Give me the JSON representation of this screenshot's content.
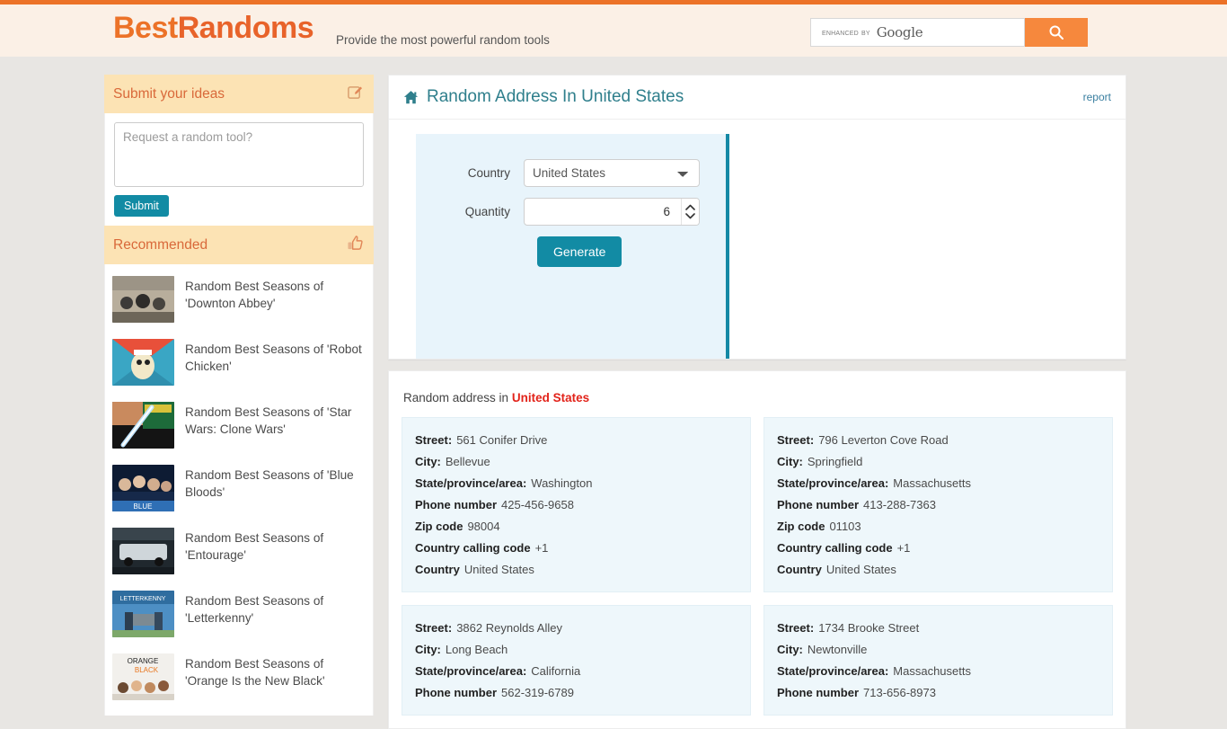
{
  "header": {
    "brand_first": "Best",
    "brand_second": "Randoms",
    "tagline": "Provide the most powerful random tools",
    "search": {
      "enhanced_label": "enhanced by",
      "google_label": "Google",
      "placeholder": "",
      "value": "",
      "button_icon": "search-icon"
    },
    "accent_color": "#ec7228",
    "background_color": "#fbf0e6"
  },
  "sidebar": {
    "ideas_panel": {
      "title": "Submit your ideas",
      "icon": "edit-pencil-icon",
      "textarea_placeholder": "Request a random tool?",
      "textarea_value": "",
      "submit_label": "Submit"
    },
    "recommended_panel": {
      "title": "Recommended",
      "icon": "thumbs-up-icon",
      "items": [
        {
          "label": "Random Best Seasons of 'Downton Abbey'",
          "thumb": "downton-abbey-thumb"
        },
        {
          "label": "Random Best Seasons of 'Robot Chicken'",
          "thumb": "robot-chicken-thumb"
        },
        {
          "label": "Random Best Seasons of 'Star Wars: Clone Wars'",
          "thumb": "star-wars-clone-wars-thumb"
        },
        {
          "label": "Random Best Seasons of 'Blue Bloods'",
          "thumb": "blue-bloods-thumb"
        },
        {
          "label": "Random Best Seasons of 'Entourage'",
          "thumb": "entourage-thumb"
        },
        {
          "label": "Random Best Seasons of 'Letterkenny'",
          "thumb": "letterkenny-thumb"
        },
        {
          "label": "Random Best Seasons of 'Orange Is the New Black'",
          "thumb": "orange-is-the-new-black-thumb"
        }
      ]
    }
  },
  "main": {
    "page_title": "Random Address In United States",
    "home_icon": "home-icon",
    "report_label": "report",
    "accent_color": "#1589a5",
    "form": {
      "country_label": "Country",
      "country_value": "United States",
      "country_options": [
        "United States"
      ],
      "quantity_label": "Quantity",
      "quantity_value": "6",
      "generate_label": "Generate"
    },
    "results": {
      "heading_prefix": "Random address in ",
      "heading_country": "United States",
      "field_labels": {
        "street": "Street:",
        "city": "City:",
        "state": "State/province/area:",
        "phone": "Phone number",
        "zip": "Zip code",
        "calling_code": "Country calling code",
        "country": "Country"
      },
      "addresses": [
        {
          "street": "561 Conifer Drive",
          "city": "Bellevue",
          "state": "Washington",
          "phone": "425-456-9658",
          "zip": "98004",
          "calling_code": "+1",
          "country": "United States"
        },
        {
          "street": "796 Leverton Cove Road",
          "city": "Springfield",
          "state": "Massachusetts",
          "phone": "413-288-7363",
          "zip": "01103",
          "calling_code": "+1",
          "country": "United States"
        },
        {
          "street": "3862 Reynolds Alley",
          "city": "Long Beach",
          "state": "California",
          "phone": "562-319-6789",
          "zip": "",
          "calling_code": "",
          "country": ""
        },
        {
          "street": "1734 Brooke Street",
          "city": "Newtonville",
          "state": "Massachusetts",
          "phone": "713-656-8973",
          "zip": "",
          "calling_code": "",
          "country": ""
        }
      ]
    }
  }
}
